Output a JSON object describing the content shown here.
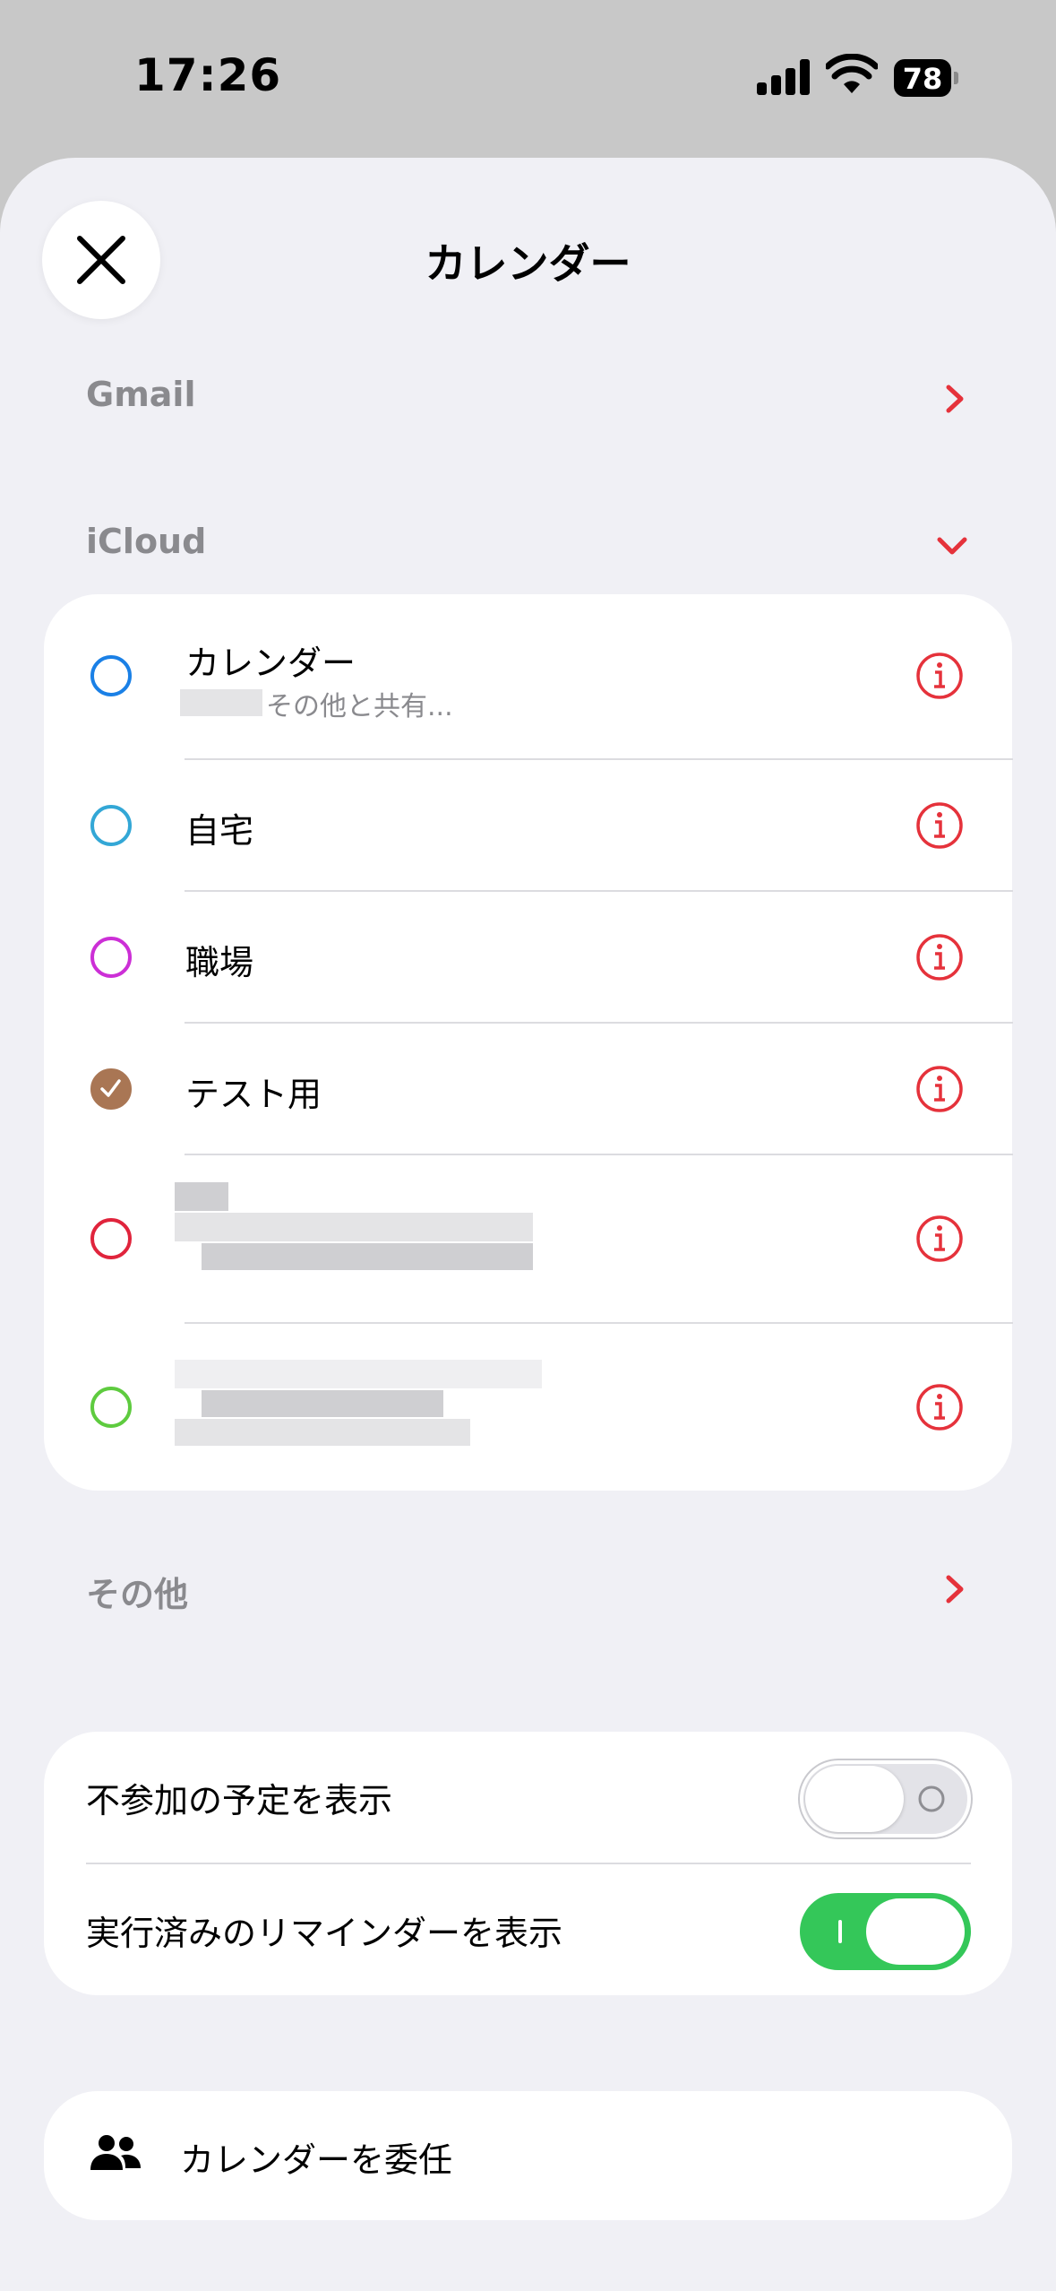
{
  "status_bar": {
    "time": "17:26",
    "battery": "78"
  },
  "sheet": {
    "title": "カレンダー"
  },
  "sections": {
    "gmail": "Gmail",
    "icloud": "iCloud",
    "other": "その他"
  },
  "icloud_calendars": [
    {
      "label": "カレンダー",
      "subtitle": "その他と共有...",
      "color": "#1a80e6",
      "checked": false
    },
    {
      "label": "自宅",
      "color": "#33a7d6",
      "checked": false
    },
    {
      "label": "職場",
      "color": "#cc2fd6",
      "checked": false
    },
    {
      "label": "テスト用",
      "color": "#a97654",
      "checked": true
    },
    {
      "label": "",
      "color": "#e0243c",
      "checked": false
    },
    {
      "label": "",
      "color": "#5ecb3f",
      "checked": false
    }
  ],
  "settings": {
    "show_declined": {
      "label": "不参加の予定を表示",
      "on": false
    },
    "show_completed_reminders": {
      "label": "実行済みのリマインダーを表示",
      "on": true
    }
  },
  "delegate": {
    "label": "カレンダーを委任"
  },
  "colors": {
    "accent": "#e5323b",
    "toggle_on": "#34c759",
    "toggle_off": "#e3e3e8"
  }
}
